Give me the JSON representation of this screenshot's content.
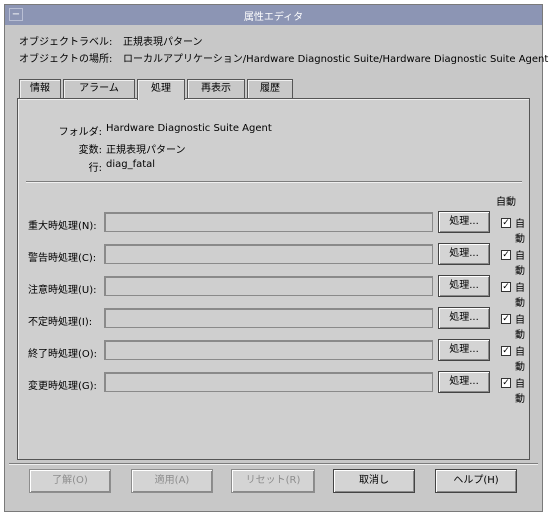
{
  "window": {
    "title": "属性エディタ",
    "menu_glyph": "−"
  },
  "header": {
    "object_label_caption": "オブジェクトラベル:",
    "object_label_value": "正規表現パターン",
    "object_location_caption": "オブジェクトの場所:",
    "object_location_value": "ローカルアプリケーション/Hardware Diagnostic Suite/Hardware Diagnostic Suite Agent"
  },
  "tabs": [
    {
      "label": "情報",
      "active": false
    },
    {
      "label": "アラーム",
      "active": false
    },
    {
      "label": "処理",
      "active": true
    },
    {
      "label": "再表示",
      "active": false
    },
    {
      "label": "履歴",
      "active": false
    }
  ],
  "info": {
    "folder_label": "フォルダ:",
    "folder_value": "Hardware Diagnostic Suite Agent",
    "variable_label": "変数:",
    "variable_value": "正規表現パターン",
    "row_label": "行:",
    "row_value": "diag_fatal"
  },
  "auto_header": "自動",
  "actions": [
    {
      "label": "重大時処理(N):",
      "value": "",
      "button": "処理...",
      "auto_label": "自動",
      "checked": true
    },
    {
      "label": "警告時処理(C):",
      "value": "",
      "button": "処理...",
      "auto_label": "自動",
      "checked": true
    },
    {
      "label": "注意時処理(U):",
      "value": "",
      "button": "処理...",
      "auto_label": "自動",
      "checked": true
    },
    {
      "label": "不定時処理(I):",
      "value": "",
      "button": "処理...",
      "auto_label": "自動",
      "checked": true
    },
    {
      "label": "終了時処理(O):",
      "value": "",
      "button": "処理...",
      "auto_label": "自動",
      "checked": true
    },
    {
      "label": "変更時処理(G):",
      "value": "",
      "button": "処理...",
      "auto_label": "自動",
      "checked": true
    }
  ],
  "footer": {
    "ok": "了解(O)",
    "apply": "適用(A)",
    "reset": "リセット(R)",
    "cancel": "取消し",
    "help": "ヘルプ(H)"
  }
}
